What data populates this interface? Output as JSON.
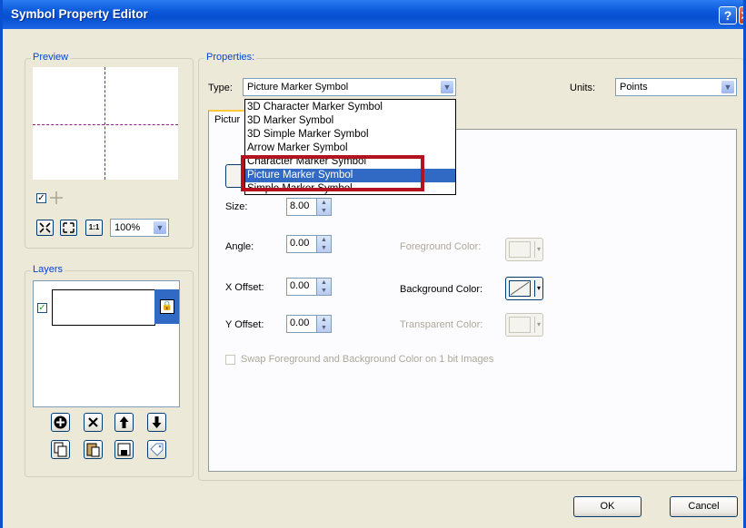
{
  "window": {
    "title": "Symbol Property Editor",
    "help_glyph": "?",
    "close_glyph": "✕"
  },
  "preview": {
    "label": "Preview",
    "zoom": "100%",
    "zoom_buttons": [
      "zoom-fit-icon",
      "zoom-extent-icon",
      "actual-size-icon"
    ],
    "actual_size_glyph": "1:1"
  },
  "layers": {
    "label": "Layers",
    "buttons_row1": [
      "add-layer-icon",
      "delete-layer-icon",
      "move-up-icon",
      "move-down-icon"
    ],
    "buttons_row2": [
      "copy-icon",
      "paste-icon",
      "save-icon",
      "tag-icon"
    ]
  },
  "properties": {
    "label": "Properties:",
    "type_label": "Type:",
    "type_value": "Picture Marker Symbol",
    "units_label": "Units:",
    "units_value": "Points",
    "tab_label": "Pictur",
    "type_options": [
      "3D Character Marker Symbol",
      "3D Marker Symbol",
      "3D Simple Marker Symbol",
      "Arrow Marker Symbol",
      "Character Marker Symbol",
      "Picture Marker Symbol",
      "Simple Marker Symbol"
    ],
    "selected_index": 5
  },
  "fields": {
    "size_label": "Size:",
    "size_value": "8.00",
    "angle_label": "Angle:",
    "angle_value": "0.00",
    "xoffset_label": "X Offset:",
    "xoffset_value": "0.00",
    "yoffset_label": "Y Offset:",
    "yoffset_value": "0.00",
    "fg_label": "Foreground Color:",
    "bg_label": "Background Color:",
    "tr_label": "Transparent Color:",
    "swap_label": "Swap Foreground and Background Color on 1 bit Images"
  },
  "buttons": {
    "ok": "OK",
    "cancel": "Cancel"
  },
  "colors": {
    "accent": "#316AC5",
    "highlight_box": "#B2131F",
    "titlebar": "#0A58D8"
  }
}
